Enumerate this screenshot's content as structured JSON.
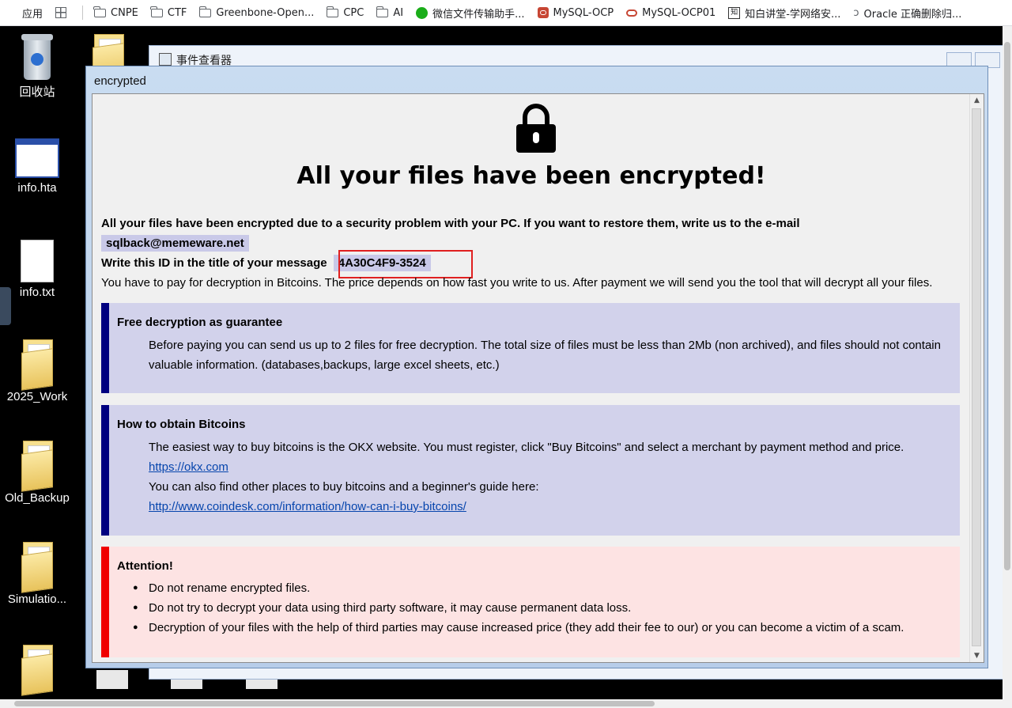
{
  "bookmarks": {
    "apps_label": "应用",
    "items": [
      "CNPE",
      "CTF",
      "Greenbone-Open...",
      "CPC",
      "AI",
      "微信文件传输助手...",
      "MySQL-OCP",
      "MySQL-OCP01",
      "知白讲堂-学网络安...",
      "Oracle 正确删除归..."
    ]
  },
  "desktop": {
    "icons": [
      "回收站",
      "info.hta",
      "info.txt",
      "2025_Work",
      "Old_Backup",
      "Simulatio..."
    ]
  },
  "background_window": {
    "title": "事件查看器"
  },
  "window": {
    "title": "encrypted",
    "heading": "All your files have been encrypted!",
    "intro": "All your files have been encrypted due to a security problem with your PC. If you want to restore them, write us to the e-mail",
    "email": "sqlback@memeware.net",
    "id_prompt": "Write this ID in the title of your message",
    "id_value": "4A30C4F9-3524",
    "payment_text": "You have to pay for decryption in Bitcoins. The price depends on how fast you write to us. After payment we will send you the tool that will decrypt all your files.",
    "free": {
      "title": "Free decryption as guarantee",
      "text": "Before paying you can send us up to 2 files for free decryption. The total size of files must be less than 2Mb (non archived), and files should not contain valuable information. (databases,backups, large excel sheets, etc.)"
    },
    "bitcoin": {
      "title": "How to obtain Bitcoins",
      "line1": "The easiest way to buy bitcoins is the OKX website. You must register, click \"Buy Bitcoins\" and select a merchant by payment method and price.",
      "link1": "https://okx.com",
      "line2": "You can also find other places to buy bitcoins and a beginner's guide here:",
      "link2": "http://www.coindesk.com/information/how-can-i-buy-bitcoins/"
    },
    "attention": {
      "title": "Attention!",
      "items": [
        "Do not rename encrypted files.",
        "Do not try to decrypt your data using third party software, it may cause permanent data loss.",
        "Decryption of your files with the help of third parties may cause increased price (they add their fee to our) or you can become a victim of a scam."
      ]
    }
  },
  "colors": {
    "guarantee_border": "#000080",
    "attention_border": "#f00000",
    "id_highlight": "#e02020"
  }
}
